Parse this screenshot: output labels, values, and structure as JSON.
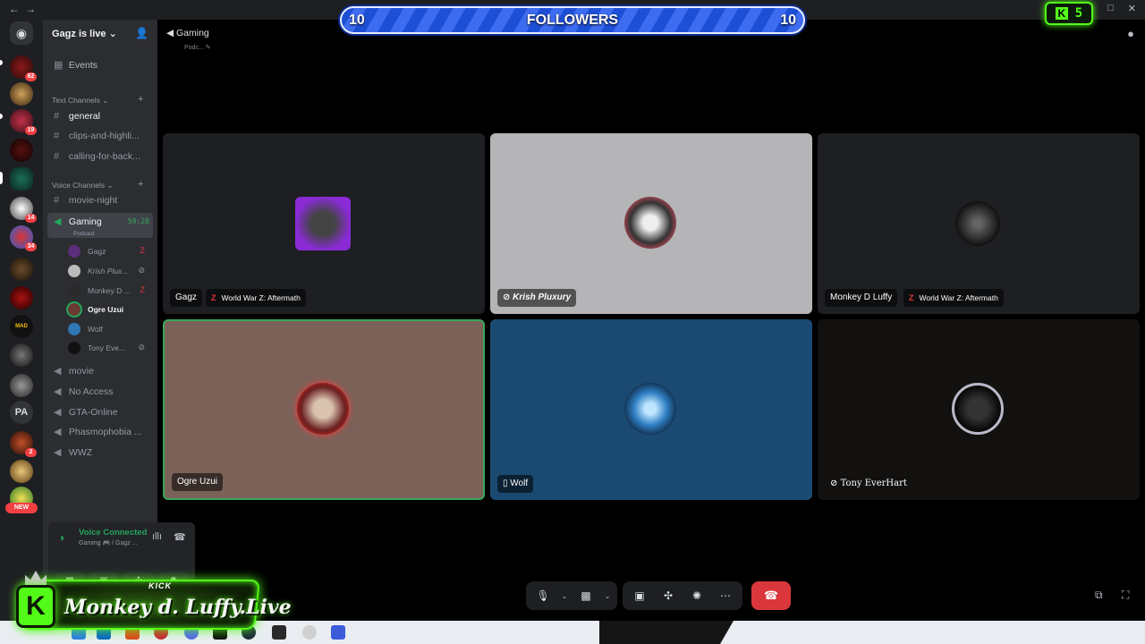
{
  "banner": {
    "left_count": "10",
    "title": "FOLLOWERS",
    "right_count": "10"
  },
  "kick_badge": {
    "icon": "K",
    "count": "5"
  },
  "server_rail": {
    "badges": [
      "62",
      "19",
      "14",
      "34",
      "2"
    ],
    "text_server": "PA",
    "new_label": "NEW"
  },
  "server": {
    "name": "Gagz is live"
  },
  "sidebar": {
    "events": "Events",
    "text_category": "Text Channels",
    "text_channels": [
      "general",
      "clips-and-highli...",
      "calling-for-back..."
    ],
    "voice_category": "Voice Channels",
    "voice_channels": [
      {
        "name": "movie-night"
      },
      {
        "name": "Gaming",
        "sub": "Podcast",
        "timer": "59:28"
      },
      {
        "name": "movie"
      },
      {
        "name": "No Access"
      },
      {
        "name": "GTA-Online"
      },
      {
        "name": "Phasmophobia ..."
      },
      {
        "name": "WWZ"
      }
    ],
    "voice_users": [
      "Gagz",
      "Krish Plux...",
      "Monkey D ...",
      "Ogre Uzui",
      "Wolf",
      "Tony Eve..."
    ]
  },
  "voice_panel": {
    "status": "Voice Connected",
    "sub": "Gaming 🎮 / Gagz ..."
  },
  "main_header": {
    "title": "Gaming",
    "subtitle": "Podc..."
  },
  "tiles": [
    {
      "name": "Gagz",
      "game": "World War Z: Aftermath",
      "bg": "#1e1f22"
    },
    {
      "name": "Krish Pluxury",
      "game": "",
      "bg": "#b5b5b7"
    },
    {
      "name": "Monkey D Luffy",
      "game": "World War Z: Aftermath",
      "bg": "#1e1f22"
    },
    {
      "name": "Ogre Uzui",
      "game": "",
      "bg": "#7a6259"
    },
    {
      "name": "Wolf",
      "game": "",
      "bg": "#1a4a72"
    },
    {
      "name": "Tony EverHart",
      "game": "",
      "bg": "#12110f"
    }
  ],
  "kick_overlay": {
    "tag": "KICK",
    "name": "Monkey d. Luffy.Live"
  },
  "colors": {
    "speaking_border": "#3ba55c",
    "kick_green": "#53fc18",
    "end_call": "#da373c"
  },
  "icons": {
    "titlebar": [
      "back-icon",
      "forward-icon",
      "minimize-icon",
      "maximize-icon",
      "close-icon"
    ],
    "controls": [
      "mic-icon",
      "camera-off-icon",
      "screen-share-icon",
      "activities-icon",
      "soundboard-icon",
      "more-icon",
      "hang-up-icon"
    ]
  }
}
